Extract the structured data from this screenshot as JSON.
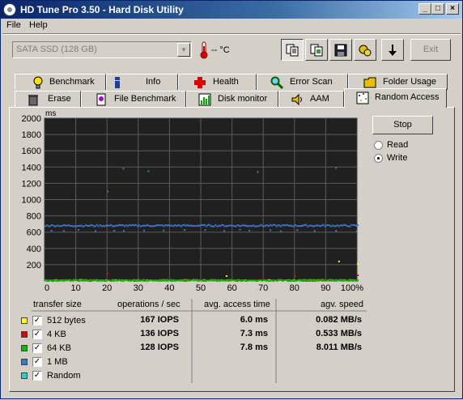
{
  "window": {
    "title": "HD Tune Pro 3.50 - Hard Disk Utility"
  },
  "menu": {
    "file": "File",
    "help": "Help"
  },
  "toolbar": {
    "drive": "SATA SSD (128 GB)",
    "temperature": "-- °C",
    "exit_label": "Exit",
    "buttons": [
      "copy-info-icon",
      "copy-screenshot-icon",
      "save-icon",
      "options-icon",
      "down-arrow-icon"
    ]
  },
  "tabs_row1": [
    {
      "label": "Benchmark",
      "icon": "lightbulb-icon"
    },
    {
      "label": "Info",
      "icon": "info-icon"
    },
    {
      "label": "Health",
      "icon": "health-cross-icon"
    },
    {
      "label": "Error Scan",
      "icon": "magnifier-icon"
    },
    {
      "label": "Folder Usage",
      "icon": "folder-icon"
    }
  ],
  "tabs_row2": [
    {
      "label": "Erase",
      "icon": "trash-icon"
    },
    {
      "label": "File Benchmark",
      "icon": "file-benchmark-icon"
    },
    {
      "label": "Disk monitor",
      "icon": "disk-monitor-icon"
    },
    {
      "label": "AAM",
      "icon": "speaker-icon"
    },
    {
      "label": "Random Access",
      "icon": "random-access-icon"
    }
  ],
  "controls": {
    "stop_label": "Stop",
    "read_label": "Read",
    "write_label": "Write",
    "mode": "Write"
  },
  "colors": {
    "512 bytes": "#ffff00",
    "4 KB": "#e00000",
    "64 KB": "#00c000",
    "1 MB": "#3a78d0",
    "Random": "#2ad0d0",
    "plot_bg": "#202020",
    "grid": "#5a5a5a"
  },
  "table": {
    "headers": {
      "size": "transfer size",
      "ops": "operations / sec",
      "access": "avg. access time",
      "speed": "agv. speed"
    },
    "rows": [
      {
        "label": "512 bytes",
        "color": "#ffff00",
        "checked": true,
        "ops": "167 IOPS",
        "access": "6.0 ms",
        "speed": "0.082 MB/s"
      },
      {
        "label": "4 KB",
        "color": "#e00000",
        "checked": true,
        "ops": "136 IOPS",
        "access": "7.3 ms",
        "speed": "0.533 MB/s"
      },
      {
        "label": "64 KB",
        "color": "#00c000",
        "checked": true,
        "ops": "128 IOPS",
        "access": "7.8 ms",
        "speed": "8.011 MB/s"
      },
      {
        "label": "1 MB",
        "color": "#3a78d0",
        "checked": true,
        "ops": "",
        "access": "",
        "speed": ""
      },
      {
        "label": "Random",
        "color": "#2ad0d0",
        "checked": true,
        "ops": "",
        "access": "",
        "speed": ""
      }
    ]
  },
  "chart_data": {
    "type": "scatter",
    "xlabel": "",
    "ylabel": "ms",
    "xlim": [
      0,
      100
    ],
    "ylim": [
      0,
      2000
    ],
    "xticks": [
      "0",
      "10",
      "20",
      "30",
      "40",
      "50",
      "60",
      "70",
      "80",
      "90",
      "100%"
    ],
    "yticks": [
      "200",
      "400",
      "600",
      "800",
      "1000",
      "1200",
      "1400",
      "1600",
      "1800",
      "2000"
    ],
    "grid": true,
    "series": [
      {
        "name": "512 bytes",
        "color": "#ffff00",
        "level": 6,
        "outliers": [
          [
            58,
            60
          ],
          [
            94,
            240
          ],
          [
            100,
            210
          ]
        ]
      },
      {
        "name": "4 KB",
        "color": "#e00000",
        "level": 7,
        "outliers": [
          [
            20,
            90
          ],
          [
            80,
            60
          ],
          [
            100,
            70
          ]
        ]
      },
      {
        "name": "64 KB",
        "color": "#00c000",
        "level": 8,
        "outliers": []
      },
      {
        "name": "1 MB",
        "color": "#3a78d0",
        "level": 680,
        "secondary": 620,
        "outliers": [
          [
            25,
            1380
          ],
          [
            33,
            1350
          ],
          [
            20,
            1100
          ],
          [
            93,
            1390
          ],
          [
            68,
            1340
          ]
        ]
      },
      {
        "name": "Random",
        "color": "#2ad0d0",
        "level": 0,
        "outliers": []
      }
    ]
  }
}
